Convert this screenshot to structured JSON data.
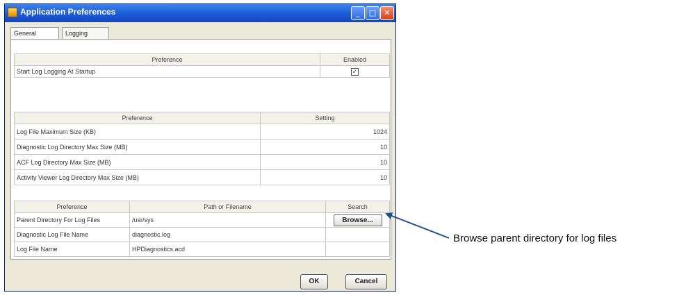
{
  "window": {
    "title": "Application Preferences",
    "tabs": {
      "general": "General",
      "logging": "Logging"
    }
  },
  "startup_table": {
    "headers": {
      "preference": "Preference",
      "enabled": "Enabled"
    },
    "rows": [
      {
        "label": "Start Log Logging At Startup",
        "checked": "✓"
      }
    ]
  },
  "settings_table": {
    "headers": {
      "preference": "Preference",
      "setting": "Setting"
    },
    "rows": [
      {
        "label": "Log File Maximum Size (KB)",
        "value": "1024"
      },
      {
        "label": "Diagnostic Log Directory Max Size (MB)",
        "value": "10"
      },
      {
        "label": "ACF Log Directory Max Size (MB)",
        "value": "10"
      },
      {
        "label": "Activity Viewer Log Directory Max Size (MB)",
        "value": "10"
      }
    ]
  },
  "paths_table": {
    "headers": {
      "preference": "Preference",
      "path": "Path or Filename",
      "search": "Search"
    },
    "rows": [
      {
        "label": "Parent Directory For Log Files",
        "value": "/usr/sys",
        "browse": "Browse..."
      },
      {
        "label": "Diagnostic Log File Name",
        "value": "diagnostic.log",
        "browse": ""
      },
      {
        "label": "Log File Name",
        "value": "HPDiagnostics.acd",
        "browse": ""
      }
    ]
  },
  "buttons": {
    "ok": "OK",
    "cancel": "Cancel"
  },
  "annotation": {
    "text": "Browse parent directory for log files"
  },
  "colors": {
    "titlebar": "#1c5bd6",
    "arrow": "#1f4e8c"
  }
}
